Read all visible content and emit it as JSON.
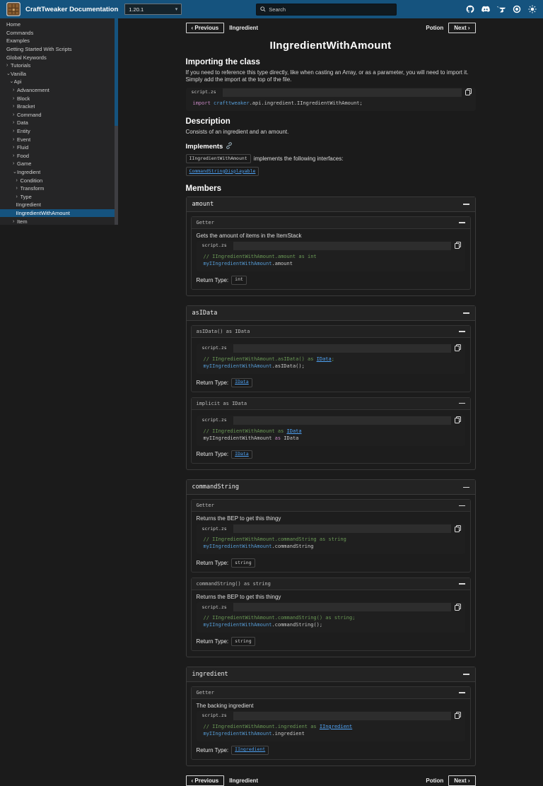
{
  "header": {
    "title": "CraftTweaker Documentation",
    "version": "1.20.1",
    "search_placeholder": "Search",
    "icons": [
      "github",
      "discord",
      "curseforge",
      "modrinth",
      "theme-toggle"
    ]
  },
  "colors": {
    "topbar": "#15537e",
    "selected_item": "#15537e",
    "link": "#4fa3f5",
    "comment": "#6a9955",
    "keyword": "#c586c0",
    "identifier": "#569cd6"
  },
  "sidebar": {
    "items": [
      {
        "label": "Home",
        "indent": 0,
        "state": "none"
      },
      {
        "label": "Commands",
        "indent": 0,
        "state": "none"
      },
      {
        "label": "Examples",
        "indent": 0,
        "state": "none"
      },
      {
        "label": "Getting Started With Scripts",
        "indent": 0,
        "state": "none"
      },
      {
        "label": "Global Keywords",
        "indent": 0,
        "state": "none"
      },
      {
        "label": "Tutorials",
        "indent": 0,
        "state": "collapsed"
      },
      {
        "label": "Vanilla",
        "indent": 0,
        "state": "expanded"
      },
      {
        "label": "Api",
        "indent": 1,
        "state": "expanded"
      },
      {
        "label": "Advancement",
        "indent": 2,
        "state": "collapsed"
      },
      {
        "label": "Block",
        "indent": 2,
        "state": "collapsed"
      },
      {
        "label": "Bracket",
        "indent": 2,
        "state": "collapsed"
      },
      {
        "label": "Command",
        "indent": 2,
        "state": "collapsed"
      },
      {
        "label": "Data",
        "indent": 2,
        "state": "collapsed"
      },
      {
        "label": "Entity",
        "indent": 2,
        "state": "collapsed"
      },
      {
        "label": "Event",
        "indent": 2,
        "state": "collapsed"
      },
      {
        "label": "Fluid",
        "indent": 2,
        "state": "collapsed"
      },
      {
        "label": "Food",
        "indent": 2,
        "state": "collapsed"
      },
      {
        "label": "Game",
        "indent": 2,
        "state": "collapsed"
      },
      {
        "label": "Ingredient",
        "indent": 2,
        "state": "expanded"
      },
      {
        "label": "Condition",
        "indent": 3,
        "state": "collapsed"
      },
      {
        "label": "Transform",
        "indent": 3,
        "state": "collapsed"
      },
      {
        "label": "Type",
        "indent": 3,
        "state": "collapsed"
      },
      {
        "label": "IIngredient",
        "indent": 3,
        "state": "none"
      },
      {
        "label": "IIngredientWithAmount",
        "indent": 3,
        "state": "none",
        "selected": true
      },
      {
        "label": "Item",
        "indent": 2,
        "state": "collapsed"
      }
    ]
  },
  "page": {
    "nav": {
      "previous_label": "‹ Previous",
      "previous_target": "IIngredient",
      "next_target": "Potion",
      "next_label": "Next ›"
    },
    "title": "IIngredientWithAmount",
    "return_type_label": "Return Type:",
    "importing": {
      "heading": "Importing the class",
      "body": "If you need to reference this type directly, like when casting an Array, or as a parameter, you will need to import it. Simply add the import at the top of the file.",
      "code": {
        "tab": "script.zs",
        "lines": [
          [
            {
              "t": "import ",
              "c": "keyword"
            },
            {
              "t": "crafttweaker",
              "c": "type"
            },
            {
              "t": ".api.ingredient.IIngredientWithAmount;",
              "c": "plain"
            }
          ]
        ]
      }
    },
    "description": {
      "heading": "Description",
      "body": "Consists of an ingredient and an amount."
    },
    "implements": {
      "heading": "Implements",
      "subject_chip": "IIngredientWithAmount",
      "text": "implements the following interfaces:",
      "links": [
        "CommandStringDisplayable"
      ]
    },
    "members_heading": "Members",
    "members": [
      {
        "name": "amount",
        "entries": [
          {
            "header": "Getter",
            "description": "Gets the amount of items in the ItemStack",
            "code": {
              "tab": "script.zs",
              "lines": [
                [
                  {
                    "t": "// IIngredientWithAmount.amount as int",
                    "c": "comment"
                  }
                ],
                [
                  {
                    "t": "myIIngredientWithAmount",
                    "c": "var"
                  },
                  {
                    "t": ".amount",
                    "c": "plain"
                  }
                ]
              ]
            },
            "return_type": {
              "value": "int",
              "link": false
            }
          }
        ]
      },
      {
        "name": "asIData",
        "entries": [
          {
            "header": "asIData() as IData",
            "code": {
              "tab": "script.zs",
              "lines": [
                [
                  {
                    "t": "// IIngredientWithAmount.asIData() as ",
                    "c": "comment"
                  },
                  {
                    "t": "IData",
                    "c": "comment-link"
                  },
                  {
                    "t": ";",
                    "c": "comment"
                  }
                ],
                [
                  {
                    "t": "myIIngredientWithAmount",
                    "c": "var"
                  },
                  {
                    "t": ".asIData();",
                    "c": "plain"
                  }
                ]
              ]
            },
            "return_type": {
              "value": "IData",
              "link": true
            }
          },
          {
            "header": "implicit as IData",
            "code": {
              "tab": "script.zs",
              "lines": [
                [
                  {
                    "t": "// IIngredientWithAmount as ",
                    "c": "comment"
                  },
                  {
                    "t": "IData",
                    "c": "comment-link"
                  }
                ],
                [
                  {
                    "t": "myIIngredientWithAmount ",
                    "c": "plain"
                  },
                  {
                    "t": "as",
                    "c": "keyword"
                  },
                  {
                    "t": " IData",
                    "c": "plain"
                  }
                ]
              ]
            },
            "return_type": {
              "value": "IData",
              "link": true
            }
          }
        ]
      },
      {
        "name": "commandString",
        "entries": [
          {
            "header": "Getter",
            "description": "Returns the BEP to get this thingy",
            "code": {
              "tab": "script.zs",
              "lines": [
                [
                  {
                    "t": "// IIngredientWithAmount.commandString as string",
                    "c": "comment"
                  }
                ],
                [
                  {
                    "t": "myIIngredientWithAmount",
                    "c": "var"
                  },
                  {
                    "t": ".commandString",
                    "c": "plain"
                  }
                ]
              ]
            },
            "return_type": {
              "value": "string",
              "link": false
            }
          },
          {
            "header": "commandString() as string",
            "description": "Returns the BEP to get this thingy",
            "code": {
              "tab": "script.zs",
              "lines": [
                [
                  {
                    "t": "// IIngredientWithAmount.commandString() as string;",
                    "c": "comment"
                  }
                ],
                [
                  {
                    "t": "myIIngredientWithAmount",
                    "c": "var"
                  },
                  {
                    "t": ".commandString();",
                    "c": "plain"
                  }
                ]
              ]
            },
            "return_type": {
              "value": "string",
              "link": false
            }
          }
        ]
      },
      {
        "name": "ingredient",
        "entries": [
          {
            "header": "Getter",
            "description": "The backing ingredient",
            "code": {
              "tab": "script.zs",
              "lines": [
                [
                  {
                    "t": "// IIngredientWithAmount.ingredient as ",
                    "c": "comment"
                  },
                  {
                    "t": "IIngredient",
                    "c": "comment-link"
                  }
                ],
                [
                  {
                    "t": "myIIngredientWithAmount",
                    "c": "var"
                  },
                  {
                    "t": ".ingredient",
                    "c": "plain"
                  }
                ]
              ]
            },
            "return_type": {
              "value": "IIngredient",
              "link": true
            }
          }
        ]
      }
    ]
  }
}
